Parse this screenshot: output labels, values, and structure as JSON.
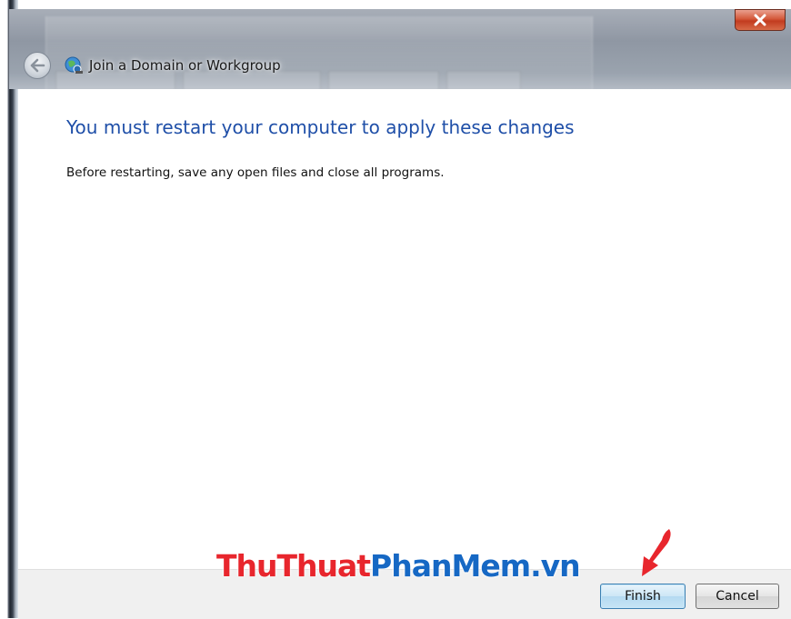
{
  "window": {
    "title": "Join a Domain or Workgroup"
  },
  "content": {
    "heading": "You must restart your computer to apply these changes",
    "message": "Before restarting, save any open files and close all programs."
  },
  "buttons": {
    "finish_label": "Finish",
    "cancel_label": "Cancel"
  },
  "watermark": {
    "part_red": "ThuThuat",
    "part_blue": "PhanMem.vn"
  },
  "colors": {
    "heading": "#1f4fa8",
    "watermark_red": "#e8262d",
    "watermark_blue": "#1668c4",
    "arrow": "#e8262d",
    "close_button": "#c23b1f"
  },
  "icons": {
    "back": "back-arrow-icon",
    "network": "network-globe-icon",
    "close": "close-x-icon",
    "pointer": "red-arrow-pointer-icon"
  }
}
